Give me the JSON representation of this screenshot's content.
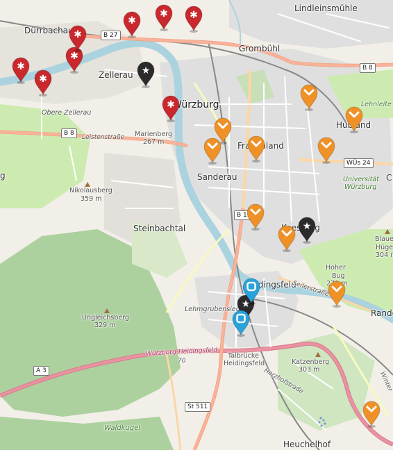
{
  "places": {
    "wuerzburg": "Würzburg",
    "duerrbachau": "Dürrbachau",
    "lindleinsmuehle": "Lindleinsmühle",
    "zellerau": "Zellerau",
    "grombuehl": "Grombühl",
    "obere_zellerau": "Obere Zellerau",
    "marienberg": "Marienberg",
    "marienberg_elev": "267 m",
    "frauenland": "Frauenland",
    "sanderau": "Sanderau",
    "hubland": "Hubland",
    "nikolausberg": "Nikolausberg",
    "nikolausberg_elev": "359 m",
    "steinbachtal": "Steinbachtal",
    "keesburg": "Keesburg",
    "heidingsfeld": "Heidingsfeld",
    "lehmgrubensiedlung": "Lehmgrubensiedl",
    "ungleicherberg": "Ungleichsberg",
    "ungleicherberg_elev": "329 m",
    "talbruecke_1": "Talbrücke",
    "talbruecke_2": "Heidingsfeld",
    "katzenberg": "Katzenberg",
    "katzenberg_elev": "303 m",
    "hoher_bug": "Hoher",
    "hoher_bug_2": "Bug",
    "hoher_bug_elev": "279 m",
    "blaue_huegel_1": "Blaue",
    "blaue_huegel_2": "Hüge",
    "blaue_huegel_elev": "304 m",
    "universitaet_1": "Universität",
    "universitaet_2": "Würzburg",
    "lehnleite": "Lehnleite",
    "waldkugel": "Waldkugel",
    "heuchelhof": "Heuchelhof",
    "rande": "Rande",
    "leistenstrasse": "Leistenstraße",
    "seilerstrasse": "Seilerstraße",
    "wuerzburg_heidingsfeld": "Würzburg-Heidingsfeld",
    "exit_70": "70",
    "herzhof": "Herzhofstraße",
    "winterhaeuser": "Winter",
    "edge_g": "g",
    "edge_c": "C"
  },
  "roads": {
    "b27": "B 27",
    "b8_east": "B 8",
    "b8_west": "B 8",
    "b19": "B 19",
    "a3": "A 3",
    "st511": "St 511",
    "wue24": "WÜs 24"
  },
  "markers": [
    {
      "type": "red",
      "icon": "asterisk",
      "name": "marker-red-1"
    },
    {
      "type": "red",
      "icon": "asterisk",
      "name": "marker-red-2"
    },
    {
      "type": "red",
      "icon": "asterisk",
      "name": "marker-red-3"
    },
    {
      "type": "red",
      "icon": "asterisk",
      "name": "marker-red-4"
    },
    {
      "type": "red",
      "icon": "asterisk",
      "name": "marker-red-5"
    },
    {
      "type": "red",
      "icon": "asterisk",
      "name": "marker-red-6"
    },
    {
      "type": "red",
      "icon": "asterisk",
      "name": "marker-red-7"
    },
    {
      "type": "red",
      "icon": "asterisk",
      "name": "marker-red-8"
    },
    {
      "type": "black",
      "icon": "star",
      "name": "marker-black-1"
    },
    {
      "type": "black",
      "icon": "star",
      "name": "marker-black-2"
    },
    {
      "type": "black",
      "icon": "star",
      "name": "marker-black-3"
    },
    {
      "type": "orange",
      "icon": "chevron-down",
      "name": "marker-orange-1"
    },
    {
      "type": "orange",
      "icon": "chevron-down",
      "name": "marker-orange-2"
    },
    {
      "type": "orange",
      "icon": "chevron-down",
      "name": "marker-orange-3"
    },
    {
      "type": "orange",
      "icon": "chevron-down",
      "name": "marker-orange-4"
    },
    {
      "type": "orange",
      "icon": "chevron-down",
      "name": "marker-orange-5"
    },
    {
      "type": "orange",
      "icon": "chevron-down",
      "name": "marker-orange-6"
    },
    {
      "type": "orange",
      "icon": "chevron-down",
      "name": "marker-orange-7"
    },
    {
      "type": "orange",
      "icon": "chevron-down",
      "name": "marker-orange-8"
    },
    {
      "type": "orange",
      "icon": "chevron-down",
      "name": "marker-orange-9"
    },
    {
      "type": "orange",
      "icon": "chevron-down",
      "name": "marker-orange-10"
    },
    {
      "type": "blue",
      "icon": "square-ring",
      "name": "marker-blue-1"
    },
    {
      "type": "blue",
      "icon": "square-ring",
      "name": "marker-blue-2"
    }
  ],
  "colors": {
    "red": "#c9282d",
    "black": "#2b2b2b",
    "orange": "#ef9126",
    "blue": "#2aa2db",
    "water": "#aad3df",
    "forest": "#add19e",
    "motorway": "#e892a2",
    "trunk": "#f9b29c",
    "primary": "#fcd6a4",
    "residential": "#e0dfdf"
  }
}
